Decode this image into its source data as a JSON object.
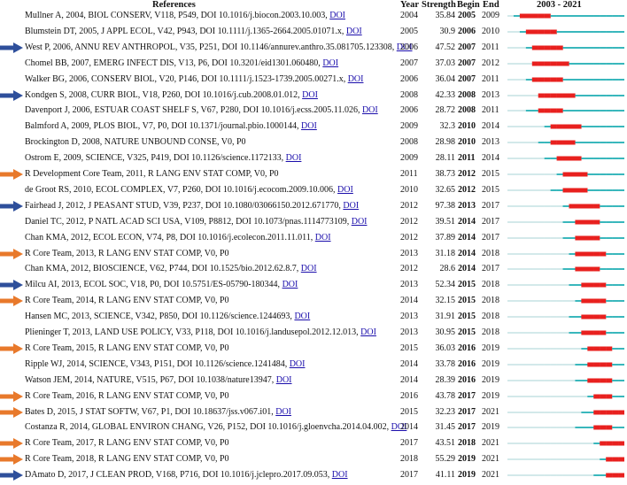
{
  "header": {
    "references": "References",
    "year": "Year",
    "strength": "Strength",
    "begin": "Begin",
    "end": "End",
    "range": "2003 - 2021"
  },
  "colors": {
    "burst": "#e8201e",
    "active": "#39b7bc",
    "inactive": "#d3e9ea",
    "arrow_blue": "#2e4f9b",
    "arrow_orange": "#e8792b"
  },
  "chart_data": {
    "type": "table",
    "timeline_start": 2003,
    "timeline_end": 2021,
    "rows": [
      {
        "ref": "Mullner A, 2004, BIOL CONSERV, V118, P549, DOI 10.1016/j.biocon.2003.10.003,",
        "doi": "DOI",
        "year": "2004",
        "strength": "35.84",
        "begin": "2005",
        "end": "2009",
        "arrow": ""
      },
      {
        "ref": "Blumstein DT, 2005, J APPL ECOL, V42, P943, DOI 10.1111/j.1365-2664.2005.01071.x,",
        "doi": "DOI",
        "year": "2005",
        "strength": "30.9",
        "begin": "2006",
        "end": "2010",
        "arrow": ""
      },
      {
        "ref": "West P, 2006, ANNU REV ANTHROPOL, V35, P251, DOI 10.1146/annurev.anthro.35.081705.123308,",
        "doi": "DOI",
        "year": "2006",
        "strength": "47.52",
        "begin": "2007",
        "end": "2011",
        "arrow": "blue"
      },
      {
        "ref": "Chomel BB, 2007, EMERG INFECT DIS, V13, P6, DOI 10.3201/eid1301.060480,",
        "doi": "DOI",
        "year": "2007",
        "strength": "37.03",
        "begin": "2007",
        "end": "2012",
        "arrow": ""
      },
      {
        "ref": "Walker BG, 2006, CONSERV BIOL, V20, P146, DOI 10.1111/j.1523-1739.2005.00271.x,",
        "doi": "DOI",
        "year": "2006",
        "strength": "36.04",
        "begin": "2007",
        "end": "2011",
        "arrow": ""
      },
      {
        "ref": "Kondgen S, 2008, CURR BIOL, V18, P260, DOI 10.1016/j.cub.2008.01.012,",
        "doi": "DOI",
        "year": "2008",
        "strength": "42.33",
        "begin": "2008",
        "end": "2013",
        "arrow": "blue"
      },
      {
        "ref": "Davenport J, 2006, ESTUAR COAST SHELF S, V67, P280, DOI 10.1016/j.ecss.2005.11.026,",
        "doi": "DOI",
        "year": "2006",
        "strength": "28.72",
        "begin": "2008",
        "end": "2011",
        "arrow": ""
      },
      {
        "ref": "Balmford A, 2009, PLOS BIOL, V7, P0, DOI 10.1371/journal.pbio.1000144,",
        "doi": "DOI",
        "year": "2009",
        "strength": "32.3",
        "begin": "2010",
        "end": "2014",
        "arrow": ""
      },
      {
        "ref": "Brockington D, 2008, NATURE UNBOUND CONSE, V0, P0",
        "doi": "",
        "year": "2008",
        "strength": "28.98",
        "begin": "2010",
        "end": "2013",
        "arrow": ""
      },
      {
        "ref": "Ostrom E, 2009, SCIENCE, V325, P419, DOI 10.1126/science.1172133,",
        "doi": "DOI",
        "year": "2009",
        "strength": "28.11",
        "begin": "2011",
        "end": "2014",
        "arrow": ""
      },
      {
        "ref": "R Development Core Team, 2011, R LANG ENV STAT COMP, V0, P0",
        "doi": "",
        "year": "2011",
        "strength": "38.73",
        "begin": "2012",
        "end": "2015",
        "arrow": "orange"
      },
      {
        "ref": "de Groot RS, 2010, ECOL COMPLEX, V7, P260, DOI 10.1016/j.ecocom.2009.10.006,",
        "doi": "DOI",
        "year": "2010",
        "strength": "32.65",
        "begin": "2012",
        "end": "2015",
        "arrow": ""
      },
      {
        "ref": "Fairhead J, 2012, J PEASANT STUD, V39, P237, DOI 10.1080/03066150.2012.671770,",
        "doi": "DOI",
        "year": "2012",
        "strength": "97.38",
        "begin": "2013",
        "end": "2017",
        "arrow": "blue"
      },
      {
        "ref": "Daniel TC, 2012, P NATL ACAD SCI USA, V109, P8812, DOI 10.1073/pnas.1114773109,",
        "doi": "DOI",
        "year": "2012",
        "strength": "39.51",
        "begin": "2014",
        "end": "2017",
        "arrow": ""
      },
      {
        "ref": "Chan KMA, 2012, ECOL ECON, V74, P8, DOI 10.1016/j.ecolecon.2011.11.011,",
        "doi": "DOI",
        "year": "2012",
        "strength": "37.89",
        "begin": "2014",
        "end": "2017",
        "arrow": ""
      },
      {
        "ref": "R Core Team, 2013, R LANG ENV STAT COMP, V0, P0",
        "doi": "",
        "year": "2013",
        "strength": "31.18",
        "begin": "2014",
        "end": "2018",
        "arrow": "orange"
      },
      {
        "ref": "Chan KMA, 2012, BIOSCIENCE, V62, P744, DOI 10.1525/bio.2012.62.8.7,",
        "doi": "DOI",
        "year": "2012",
        "strength": "28.6",
        "begin": "2014",
        "end": "2017",
        "arrow": ""
      },
      {
        "ref": "Milcu AI, 2013, ECOL SOC, V18, P0, DOI 10.5751/ES-05790-180344,",
        "doi": "DOI",
        "year": "2013",
        "strength": "52.34",
        "begin": "2015",
        "end": "2018",
        "arrow": "blue"
      },
      {
        "ref": "R Core Team, 2014, R LANG ENV STAT COMP, V0, P0",
        "doi": "",
        "year": "2014",
        "strength": "32.15",
        "begin": "2015",
        "end": "2018",
        "arrow": "orange"
      },
      {
        "ref": "Hansen MC, 2013, SCIENCE, V342, P850, DOI 10.1126/science.1244693,",
        "doi": "DOI",
        "year": "2013",
        "strength": "31.91",
        "begin": "2015",
        "end": "2018",
        "arrow": ""
      },
      {
        "ref": "Plieninger T, 2013, LAND USE POLICY, V33, P118, DOI 10.1016/j.landusepol.2012.12.013,",
        "doi": "DOI",
        "year": "2013",
        "strength": "30.95",
        "begin": "2015",
        "end": "2018",
        "arrow": ""
      },
      {
        "ref": "R Core Team, 2015, R LANG ENV STAT COMP, V0, P0",
        "doi": "",
        "year": "2015",
        "strength": "36.03",
        "begin": "2016",
        "end": "2019",
        "arrow": "orange"
      },
      {
        "ref": "Ripple WJ, 2014, SCIENCE, V343, P151, DOI 10.1126/science.1241484,",
        "doi": "DOI",
        "year": "2014",
        "strength": "33.78",
        "begin": "2016",
        "end": "2019",
        "arrow": ""
      },
      {
        "ref": "Watson JEM, 2014, NATURE, V515, P67, DOI 10.1038/nature13947,",
        "doi": "DOI",
        "year": "2014",
        "strength": "28.39",
        "begin": "2016",
        "end": "2019",
        "arrow": ""
      },
      {
        "ref": "R Core Team, 2016, R LANG ENV STAT COMP, V0, P0",
        "doi": "",
        "year": "2016",
        "strength": "43.78",
        "begin": "2017",
        "end": "2019",
        "arrow": "orange"
      },
      {
        "ref": "Bates D, 2015, J STAT SOFTW, V67, P1, DOI 10.18637/jss.v067.i01,",
        "doi": "DOI",
        "year": "2015",
        "strength": "32.23",
        "begin": "2017",
        "end": "2021",
        "arrow": "orange"
      },
      {
        "ref": "Costanza R, 2014, GLOBAL ENVIRON CHANG, V26, P152, DOI 10.1016/j.gloenvcha.2014.04.002,",
        "doi": "DOI",
        "year": "2014",
        "strength": "31.45",
        "begin": "2017",
        "end": "2019",
        "arrow": ""
      },
      {
        "ref": "R Core Team, 2017, R LANG ENV STAT COMP, V0, P0",
        "doi": "",
        "year": "2017",
        "strength": "43.51",
        "begin": "2018",
        "end": "2021",
        "arrow": "orange"
      },
      {
        "ref": "R Core Team, 2018, R LANG ENV STAT COMP, V0, P0",
        "doi": "",
        "year": "2018",
        "strength": "55.29",
        "begin": "2019",
        "end": "2021",
        "arrow": "orange"
      },
      {
        "ref": "DAmato D, 2017, J CLEAN PROD, V168, P716, DOI 10.1016/j.jclepro.2017.09.053,",
        "doi": "DOI",
        "year": "2017",
        "strength": "41.11",
        "begin": "2019",
        "end": "2021",
        "arrow": "blue"
      }
    ]
  }
}
